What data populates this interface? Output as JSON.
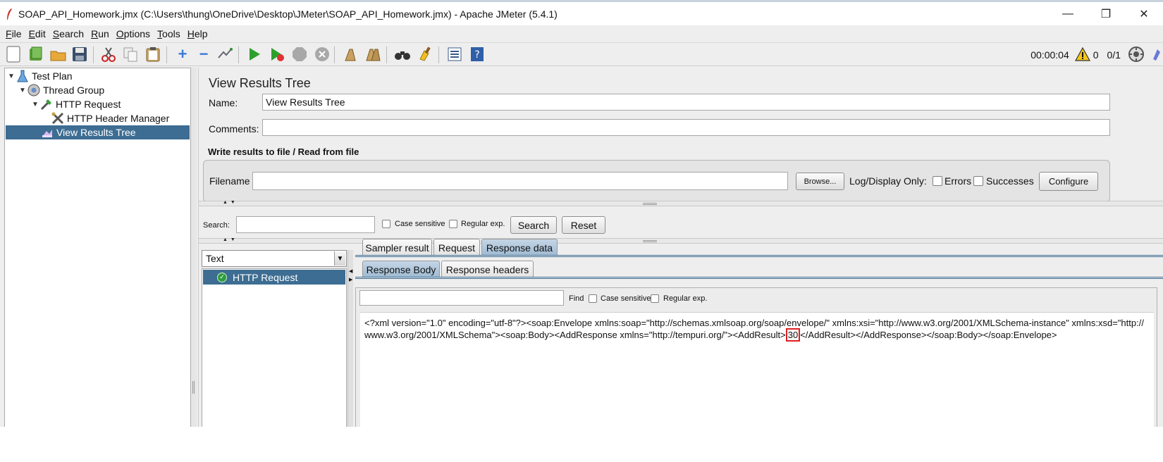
{
  "window": {
    "title": "SOAP_API_Homework.jmx (C:\\Users\\thung\\OneDrive\\Desktop\\JMeter\\SOAP_API_Homework.jmx) - Apache JMeter (5.4.1)",
    "minimize": "—",
    "restore": "❐",
    "close": "✕"
  },
  "menu": [
    "File",
    "Edit",
    "Search",
    "Run",
    "Options",
    "Tools",
    "Help"
  ],
  "toolbar": {
    "timer": "00:00:04",
    "warnings": "0",
    "threads": "0/1"
  },
  "tree": {
    "items": [
      {
        "label": "Test Plan",
        "icon": "test-plan-icon"
      },
      {
        "label": "Thread Group",
        "icon": "thread-group-icon"
      },
      {
        "label": "HTTP Request",
        "icon": "http-request-icon"
      },
      {
        "label": "HTTP Header Manager",
        "icon": "header-manager-icon"
      },
      {
        "label": "View Results Tree",
        "icon": "results-tree-icon"
      }
    ]
  },
  "panel": {
    "title": "View Results Tree",
    "name_label": "Name:",
    "name_value": "View Results Tree",
    "comments_label": "Comments:",
    "comments_value": "",
    "file_group_title": "Write results to file / Read from file",
    "filename_label": "Filename",
    "filename_value": "",
    "browse_label": "Browse...",
    "log_display_label": "Log/Display Only:",
    "errors_label": "Errors",
    "successes_label": "Successes",
    "configure_label": "Configure"
  },
  "search": {
    "label": "Search:",
    "value": "",
    "case_sensitive": "Case sensitive",
    "regular_exp": "Regular exp.",
    "search_button": "Search",
    "reset_button": "Reset"
  },
  "results": {
    "renderer": "Text",
    "samples": [
      "HTTP Request"
    ],
    "tabs": [
      "Sampler result",
      "Request",
      "Response data"
    ],
    "subtabs": [
      "Response Body",
      "Response headers"
    ],
    "find_label": "Find",
    "find_value": "",
    "find_case_sensitive": "Case sensitive",
    "find_regular_exp": "Regular exp.",
    "response_before": "<?xml version=\"1.0\" encoding=\"utf-8\"?><soap:Envelope xmlns:soap=\"http://schemas.xmlsoap.org/soap/envelope/\" xmlns:xsi=\"http://www.w3.org/2001/XMLSchema-instance\" xmlns:xsd=\"http://www.w3.org/2001/XMLSchema\"><soap:Body><AddResponse xmlns=\"http://tempuri.org/\"><AddResult>",
    "response_highlight": "30",
    "response_after": "</AddResult></AddResponse></soap:Body></soap:Envelope>"
  }
}
